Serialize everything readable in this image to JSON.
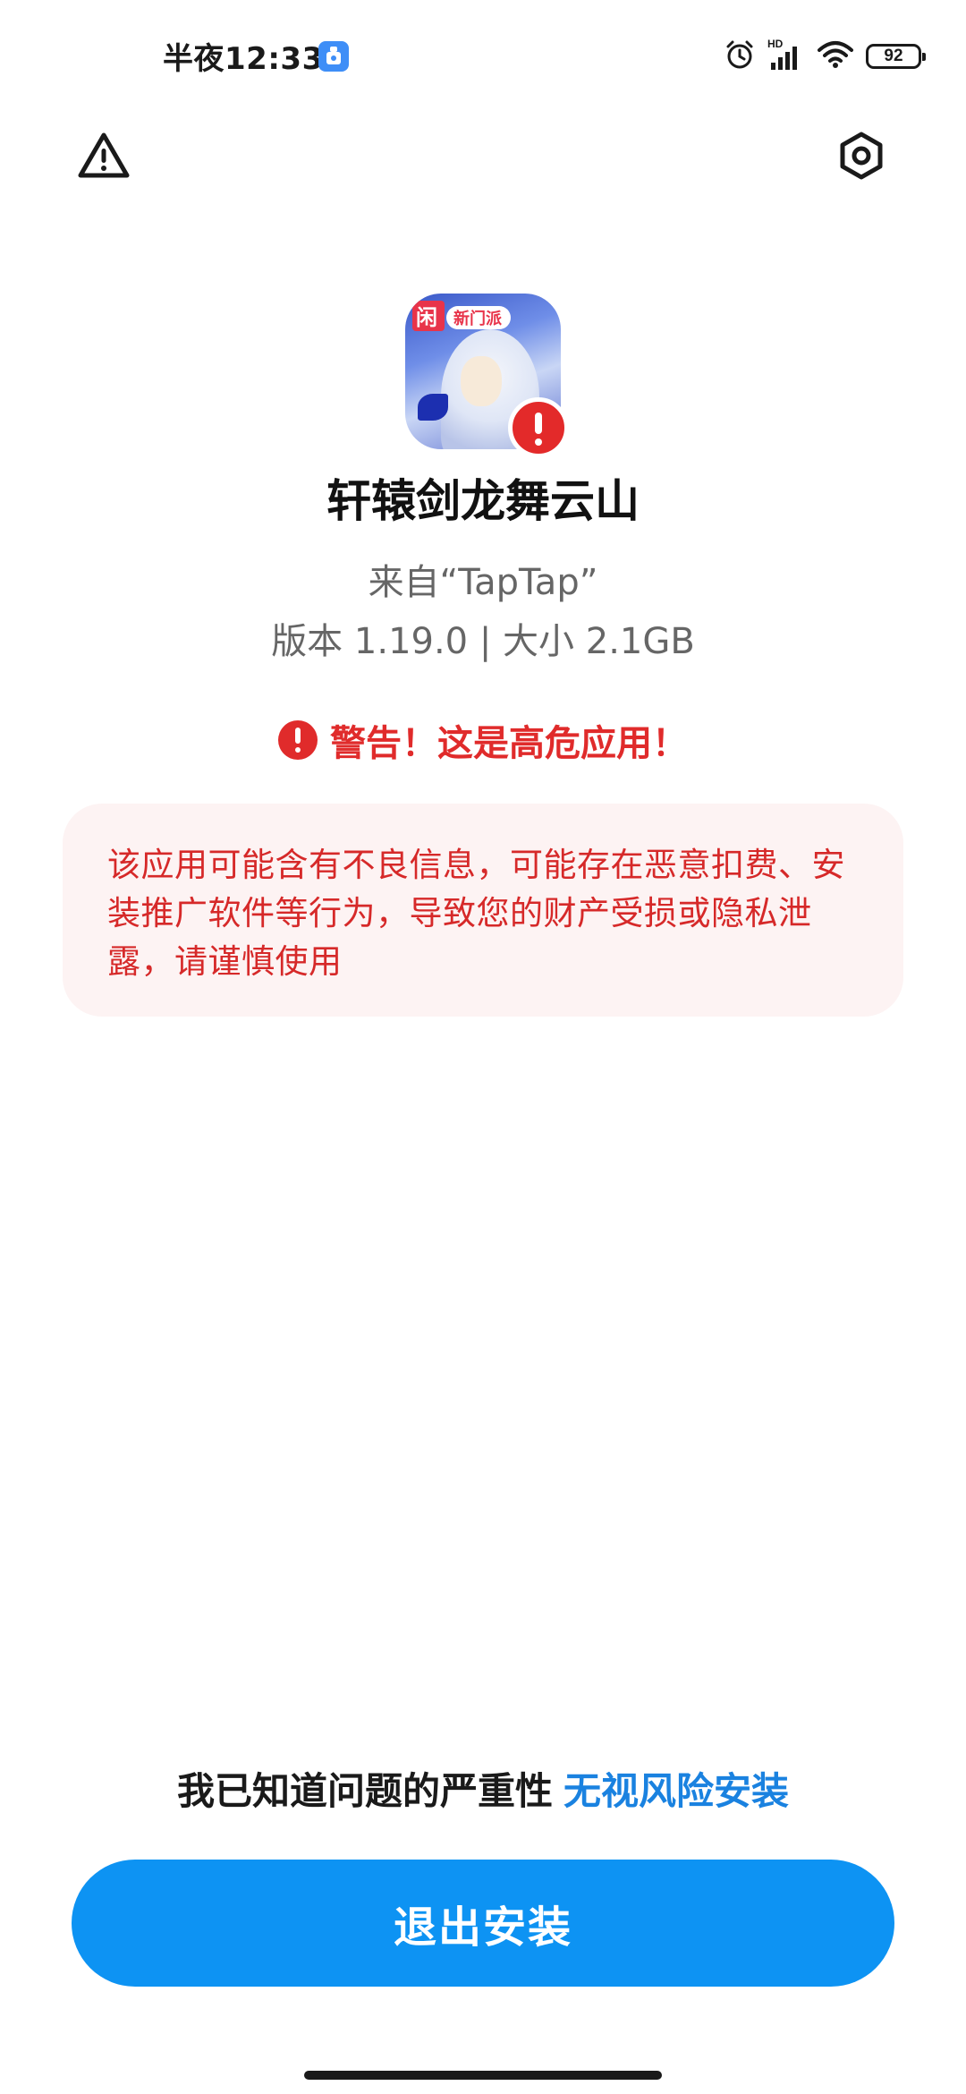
{
  "status_bar": {
    "time": "半夜12:33",
    "battery": "92",
    "network_label": "HD",
    "icons": [
      "alarm-icon",
      "signal-icon",
      "wifi-icon",
      "battery-icon"
    ]
  },
  "header": {
    "left_icon": "warning-triangle-icon",
    "right_icon": "settings-hexagon-icon"
  },
  "app": {
    "name": "轩辕剑龙舞云山",
    "source": "来自“TapTap”",
    "meta": "版本 1.19.0 | 大小 2.1GB",
    "icon_text": "新门派"
  },
  "warning": {
    "title": "警告！这是高危应用！",
    "description": "该应用可能含有不良信息，可能存在恶意扣费、安装推广软件等行为，导致您的财产受损或隐私泄露，请谨慎使用"
  },
  "actions": {
    "ignore_prefix": "我已知道问题的严重性",
    "ignore_link": "无视风险安装",
    "exit_button": "退出安装"
  },
  "colors": {
    "danger": "#e02b2b",
    "warning_bg": "#fdf3f3",
    "primary": "#0d93f3",
    "link": "#1a82e0"
  }
}
